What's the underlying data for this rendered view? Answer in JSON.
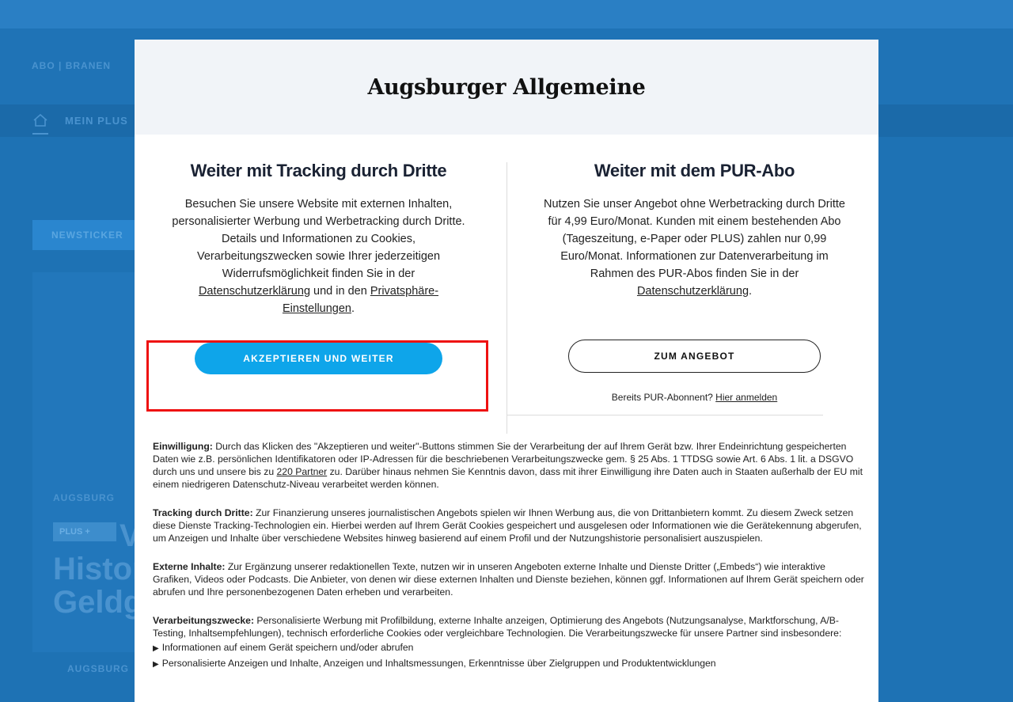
{
  "background": {
    "abo_label": "ABO | BRANEN",
    "mein_plus_label": "MEIN PLUS",
    "newsticker_label": "NEWSTICKER",
    "hero_kicker": "AUGSBURG",
    "hero_plus_badge": "PLUS +",
    "hero_headline_line1": "V",
    "hero_headline_line2": "Histor",
    "hero_headline_line3": "Geldg",
    "bottom_label": "AUGSBURG"
  },
  "modal": {
    "logo": "Augsburger Allgemeine",
    "left": {
      "title": "Weiter mit Tracking durch Dritte",
      "text_before": "Besuchen Sie unsere Website mit externen Inhalten, personalisierter Werbung und Werbetracking durch Dritte. Details und Informationen zu Cookies, Verarbeitungszwecken sowie Ihrer jederzeitigen Widerrufsmöglichkeit finden Sie in der ",
      "link_privacy": "Datenschutzerklärung",
      "text_middle": " und in den ",
      "link_settings": "Privatsphäre-Einstellungen",
      "text_after": ".",
      "accept_button": "AKZEPTIEREN UND WEITER"
    },
    "right": {
      "title": "Weiter mit dem PUR-Abo",
      "text_before": "Nutzen Sie unser Angebot ohne Werbetracking durch Dritte für 4,99 Euro/Monat. Kunden mit einem bestehenden Abo (Tageszeitung, e-Paper oder PLUS) zahlen nur 0,99 Euro/Monat. Informationen zur Datenverarbeitung im Rahmen des PUR-Abos finden Sie in der ",
      "link_privacy": "Datenschutzerklärung",
      "text_after": ".",
      "offer_button": "ZUM ANGEBOT",
      "login_prefix": "Bereits PUR-Abonnent? ",
      "login_link": "Hier anmelden"
    },
    "legal": {
      "consent_label": "Einwilligung:",
      "consent_text_1": " Durch das Klicken des \"Akzeptieren und weiter\"-Buttons stimmen Sie der Verarbeitung der auf Ihrem Gerät bzw. Ihrer Endeinrichtung gespeicherten Daten wie z.B. persönlichen Identifikatoren oder IP-Adressen für die beschriebenen Verarbeitungszwecke gem. § 25 Abs. 1 TTDSG sowie Art. 6 Abs. 1 lit. a DSGVO durch uns und unsere bis zu ",
      "consent_partner_link": "220 Partner",
      "consent_text_2": " zu. Darüber hinaus nehmen Sie Kenntnis davon, dass mit ihrer Einwilligung ihre Daten auch in Staaten außerhalb der EU mit einem niedrigeren Datenschutz-Niveau verarbeitet werden können.",
      "tracking_label": "Tracking durch Dritte:",
      "tracking_text": " Zur Finanzierung unseres journalistischen Angebots spielen wir Ihnen Werbung aus, die von Drittanbietern kommt. Zu diesem Zweck setzen diese Dienste Tracking-Technologien ein. Hierbei werden auf Ihrem Gerät Cookies gespeichert und ausgelesen oder Informationen wie die Gerätekennung abgerufen, um Anzeigen und Inhalte über verschiedene Websites hinweg basierend auf einem Profil und der Nutzungshistorie personalisiert auszuspielen.",
      "external_label": "Externe Inhalte:",
      "external_text": " Zur Ergänzung unserer redaktionellen Texte, nutzen wir in unseren Angeboten externe Inhalte und Dienste Dritter („Embeds“) wie interaktive Grafiken, Videos oder Podcasts. Die Anbieter, von denen wir diese externen Inhalten und Dienste beziehen, können ggf. Informationen auf Ihrem Gerät speichern oder abrufen und Ihre personenbezogenen Daten erheben und verarbeiten.",
      "purposes_label": "Verarbeitungszwecke:",
      "purposes_text": " Personalisierte Werbung mit Profilbildung, externe Inhalte anzeigen, Optimierung des Angebots (Nutzungsanalyse, Marktforschung, A/B-Testing, Inhaltsempfehlungen), technisch erforderliche Cookies oder vergleichbare Technologien. Die Verarbeitungszwecke für unsere Partner sind insbesondere:",
      "purpose_items": [
        "Informationen auf einem Gerät speichern und/oder abrufen",
        "Personalisierte Anzeigen und Inhalte, Anzeigen und Inhaltsmessungen, Erkenntnisse über Zielgruppen und Produktentwicklungen"
      ]
    }
  },
  "colors": {
    "accent_button": "#0ea5ea",
    "highlight_border": "#ee1111",
    "overlay_blue": "#1d6fb0"
  }
}
